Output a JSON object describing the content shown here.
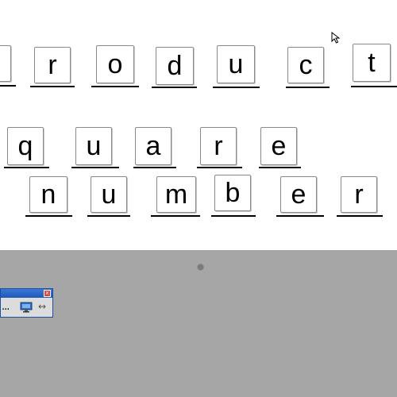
{
  "rows": [
    {
      "letters": [
        "",
        "r",
        "o",
        "d",
        "u",
        "c",
        "t"
      ]
    },
    {
      "letters": [
        "q",
        "u",
        "a",
        "r",
        "e"
      ]
    },
    {
      "letters": [
        "n",
        "u",
        "m",
        "b",
        "e",
        "r"
      ]
    }
  ],
  "toolbar": {
    "close_label": "x",
    "more_label": "...",
    "arrows_label": "↔"
  }
}
